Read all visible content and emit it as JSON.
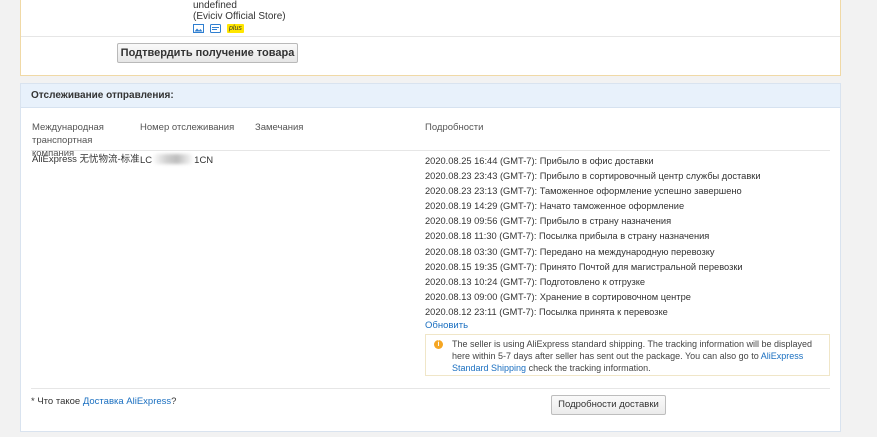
{
  "seller": {
    "name": "undefined",
    "store": "(Eviciv Official Store)",
    "badge": "plus",
    "icons": [
      "image-icon",
      "card-icon"
    ]
  },
  "confirm_button": "Подтвердить получение товара",
  "tracking": {
    "title": "Отслеживание отправления:",
    "columns": {
      "carrier": "Международная транспортная компания",
      "number": "Номер отслеживания",
      "remarks": "Замечания",
      "details": "Подробности"
    },
    "carrier": "AliExpress 无忧物流-标准",
    "number_prefix": "LC",
    "number_suffix": "1CN",
    "events": [
      "2020.08.25 16:44 (GMT-7): Прибыло в офис доставки",
      "2020.08.23 23:43 (GMT-7): Прибыло в сортировочный центр службы доставки",
      "2020.08.23 23:13 (GMT-7): Таможенное оформление успешно завершено",
      "2020.08.19 14:29 (GMT-7): Начато таможенное оформление",
      "2020.08.19 09:56 (GMT-7): Прибыло в страну назначения",
      "2020.08.18 11:30 (GMT-7): Посылка прибыла в страну назначения",
      "2020.08.18 03:30 (GMT-7): Передано на международную перевозку",
      "2020.08.15 19:35 (GMT-7): Принято Почтой для магистральной перевозки",
      "2020.08.13 10:24 (GMT-7): Подготовлено к отгрузке",
      "2020.08.13 09:00 (GMT-7): Хранение в сортировочном центре",
      "2020.08.12 23:11 (GMT-7): Посылка принята к перевозке"
    ],
    "update_link": "Обновить",
    "notice": {
      "text_1": "The seller is using AliExpress standard shipping. The tracking information will be displayed here within 5-7 days after seller has sent out the package. You can also go to ",
      "link": "AliExpress Standard Shipping",
      "text_2": " check the tracking information."
    },
    "footnote_prefix": "* Что такое ",
    "footnote_link": "Доставка AliExpress",
    "footnote_suffix": "?",
    "details_button": "Подробности доставки"
  },
  "colors": {
    "link": "#1a6fc0",
    "header_bg": "#e8f1fb",
    "badge": "#ffe600",
    "notice_icon": "#f5a623"
  }
}
